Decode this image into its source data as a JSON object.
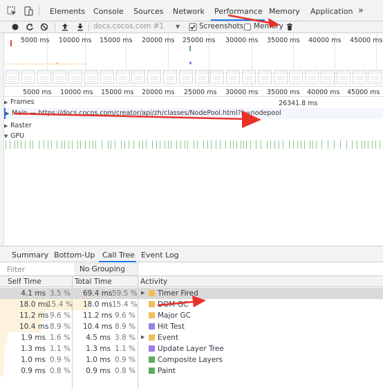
{
  "tabbar": {
    "tabs": [
      "Elements",
      "Console",
      "Sources",
      "Network",
      "Performance",
      "Memory",
      "Application"
    ],
    "active": "Performance",
    "more": "»"
  },
  "perf_toolbar": {
    "url": "docs.cocos.com #1",
    "screenshots_label": "Screenshots",
    "screenshots_checked": true,
    "memory_label": "Memory",
    "memory_checked": false
  },
  "overview": {
    "ticks": [
      "5000 ms",
      "10000 ms",
      "15000 ms",
      "20000 ms",
      "25000 ms",
      "30000 ms",
      "35000 ms",
      "40000 ms",
      "45000 ms"
    ]
  },
  "ruler": {
    "ticks": [
      "5000 ms",
      "10000 ms",
      "15000 ms",
      "20000 ms",
      "25000 ms",
      "30000 ms",
      "35000 ms",
      "40000 ms",
      "45000 ms"
    ],
    "frame_marker": "26341.8 ms"
  },
  "tracks": {
    "frames": "Frames",
    "main": "Main — https://docs.cocos.com/creator/api/zh/classes/NodePool.html?h=nodepool",
    "raster": "Raster",
    "gpu": "GPU"
  },
  "bottom": {
    "tabs": [
      "Summary",
      "Bottom-Up",
      "Call Tree",
      "Event Log"
    ],
    "active": "Call Tree",
    "filter_placeholder": "Filter",
    "grouping": "No Grouping",
    "columns": {
      "self": "Self Time",
      "total": "Total Time",
      "activity": "Activity"
    }
  },
  "calltree": [
    {
      "self_ms": "4.1 ms",
      "self_pct": "3.5 %",
      "total_ms": "69.4 ms",
      "total_pct": "59.5 %",
      "name": "Timer Fired",
      "color": "#f0c05a",
      "expandable": true,
      "selected": true,
      "self_frac": 0.035,
      "total_frac": 0.595
    },
    {
      "self_ms": "18.0 ms",
      "self_pct": "15.4 %",
      "total_ms": "18.0 ms",
      "total_pct": "15.4 %",
      "name": "DOM GC",
      "color": "#f0c05a",
      "expandable": false,
      "selected": false,
      "self_frac": 0.154,
      "total_frac": 0.154
    },
    {
      "self_ms": "11.2 ms",
      "self_pct": "9.6 %",
      "total_ms": "11.2 ms",
      "total_pct": "9.6 %",
      "name": "Major GC",
      "color": "#f0c05a",
      "expandable": false,
      "selected": false,
      "self_frac": 0.096,
      "total_frac": 0.096
    },
    {
      "self_ms": "10.4 ms",
      "self_pct": "8.9 %",
      "total_ms": "10.4 ms",
      "total_pct": "8.9 %",
      "name": "Hit Test",
      "color": "#9b7fe6",
      "expandable": false,
      "selected": false,
      "self_frac": 0.089,
      "total_frac": 0.089
    },
    {
      "self_ms": "1.9 ms",
      "self_pct": "1.6 %",
      "total_ms": "4.5 ms",
      "total_pct": "3.8 %",
      "name": "Event",
      "color": "#f0c05a",
      "expandable": true,
      "selected": false,
      "self_frac": 0.016,
      "total_frac": 0.038
    },
    {
      "self_ms": "1.3 ms",
      "self_pct": "1.1 %",
      "total_ms": "1.3 ms",
      "total_pct": "1.1 %",
      "name": "Update Layer Tree",
      "color": "#9b7fe6",
      "expandable": false,
      "selected": false,
      "self_frac": 0.011,
      "total_frac": 0.011
    },
    {
      "self_ms": "1.0 ms",
      "self_pct": "0.9 %",
      "total_ms": "1.0 ms",
      "total_pct": "0.9 %",
      "name": "Composite Layers",
      "color": "#5fab5f",
      "expandable": false,
      "selected": false,
      "self_frac": 0.009,
      "total_frac": 0.009
    },
    {
      "self_ms": "0.9 ms",
      "self_pct": "0.8 %",
      "total_ms": "0.9 ms",
      "total_pct": "0.8 %",
      "name": "Paint",
      "color": "#5fab5f",
      "expandable": false,
      "selected": false,
      "self_frac": 0.008,
      "total_frac": 0.008
    }
  ]
}
